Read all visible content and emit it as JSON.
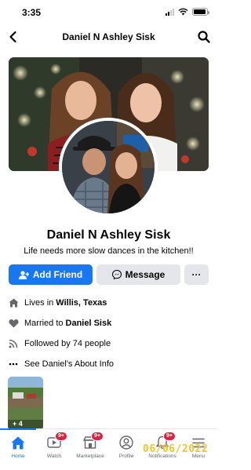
{
  "status_bar": {
    "time": "3:35",
    "battery_level": 0.95
  },
  "header": {
    "title": "Daniel N Ashley Sisk"
  },
  "profile": {
    "name": "Daniel N Ashley Sisk",
    "bio": "Life needs more slow dances in the kitchen!!"
  },
  "actions": {
    "add_friend": "Add Friend",
    "message": "Message",
    "more": "···"
  },
  "about": {
    "lives_prefix": "Lives in",
    "lives_value": "Willis, Texas",
    "married_prefix": "Married to",
    "married_value": "Daniel Sisk",
    "followed": "Followed by 74 people",
    "see_about": "See Daniel's About Info"
  },
  "photos": {
    "more_count": "+ 4"
  },
  "tab_bar": {
    "tabs": [
      {
        "label": "Home",
        "icon": "home-icon",
        "badge": ""
      },
      {
        "label": "Watch",
        "icon": "watch-icon",
        "badge": "9+"
      },
      {
        "label": "Marketplace",
        "icon": "marketplace-icon",
        "badge": "9+"
      },
      {
        "label": "Profile",
        "icon": "profile-icon",
        "badge": ""
      },
      {
        "label": "Notifications",
        "icon": "bell-icon",
        "badge": "9+"
      },
      {
        "label": "Menu",
        "icon": "menu-icon",
        "badge": ""
      }
    ]
  },
  "date_stamp": "06/06/2022",
  "colors": {
    "accent": "#1877f2",
    "badge": "#e41e3f",
    "secondary_button": "#e4e6eb",
    "date_stamp": "#f2c230"
  }
}
